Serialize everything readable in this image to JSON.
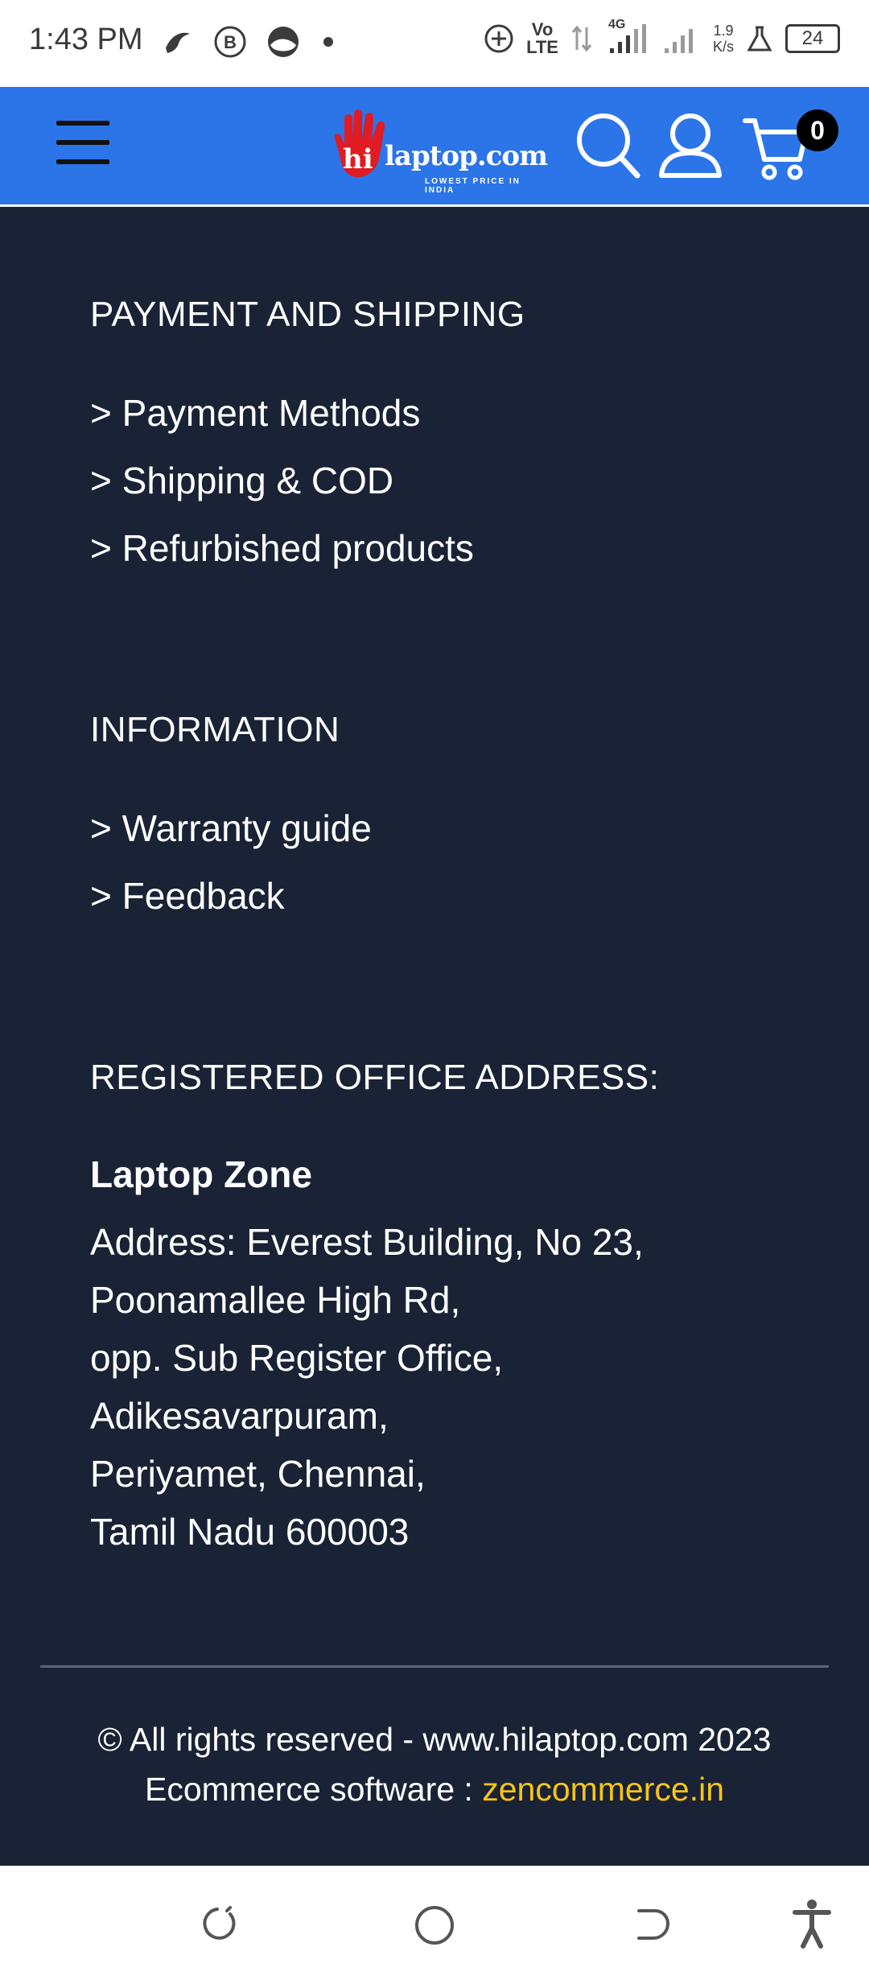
{
  "status_bar": {
    "time": "1:43 PM",
    "network_volte_top": "Vo",
    "network_volte_bottom": "LTE",
    "network_type": "4G",
    "speed_value": "1.9",
    "speed_unit": "K/s",
    "battery": "24"
  },
  "header": {
    "logo_hi": "hi",
    "logo_text": "laptop.com",
    "logo_tagline": "LOWEST PRICE IN INDIA",
    "cart_count": "0",
    "colors": {
      "background": "#2b75e8"
    }
  },
  "sections": {
    "payment": {
      "title": "PAYMENT AND SHIPPING",
      "links": [
        "> Payment Methods",
        "> Shipping & COD",
        "> Refurbished products"
      ]
    },
    "information": {
      "title": "INFORMATION",
      "links": [
        "> Warranty guide",
        "> Feedback"
      ]
    },
    "office": {
      "title": "REGISTERED OFFICE ADDRESS:",
      "company": "Laptop Zone",
      "address_lines": [
        "Address: Everest Building, No 23,",
        "Poonamallee High Rd,",
        "opp. Sub Register Office,",
        "Adikesavarpuram,",
        "Periyamet, Chennai,",
        "Tamil Nadu 600003"
      ]
    }
  },
  "footer": {
    "copyright": "© All rights reserved - www.hilaptop.com 2023",
    "software_label": "Ecommerce software : ",
    "software_link": "zencommerce.in",
    "colors": {
      "background": "#1a2335",
      "link": "#f5c518"
    }
  }
}
